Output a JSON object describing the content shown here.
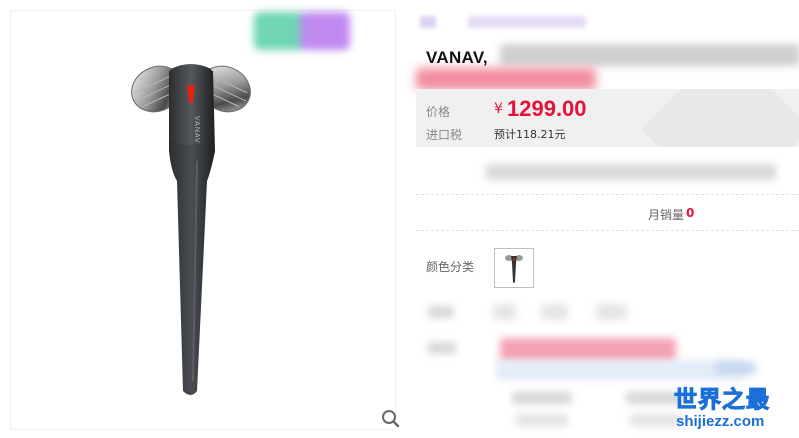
{
  "product": {
    "title": "VANAV,",
    "price_label": "价格",
    "currency_symbol": "¥",
    "price": "1299.00",
    "tax_label": "进口税",
    "tax_value": "预计118.21元",
    "monthly_sales_label": "月销量",
    "monthly_sales_value": "0",
    "color_label": "颜色分类"
  },
  "gallery": {
    "zoom_icon": "search-icon"
  },
  "watermark": {
    "name": "世界之最",
    "url": "shijiezz.com"
  },
  "colors": {
    "price_red": "#e5133a",
    "price_bg": "#f0f0f0",
    "watermark_blue": "#1a6fd8"
  }
}
